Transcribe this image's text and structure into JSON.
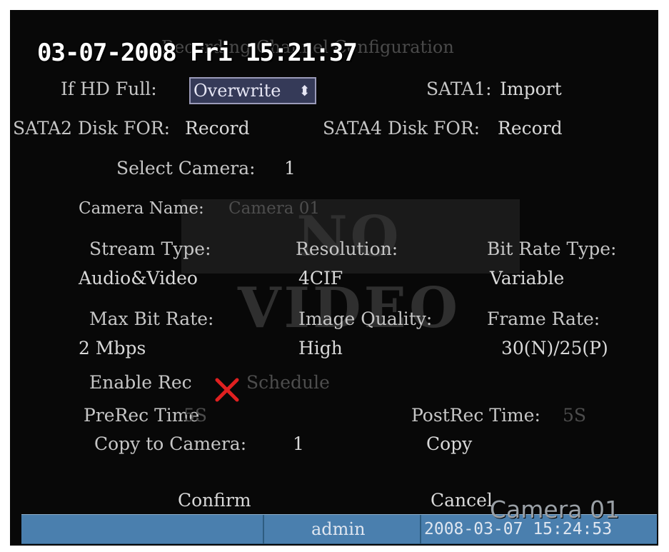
{
  "osd": {
    "datetime": "03-07-2008 Fri 15:21:37",
    "camera_label": "Camera 01",
    "no_video": "NO VIDEO"
  },
  "dialog": {
    "title": "Recording Channel Configuration",
    "hd_full_label": "If HD Full:",
    "hd_full_value": "Overwrite",
    "hd_full_arrows": "⬍",
    "sata1_label": "SATA1:",
    "sata1_value": "Import",
    "sata2_label": "SATA2 Disk FOR:",
    "sata2_value": "Record",
    "sata4_label": "SATA4 Disk FOR:",
    "sata4_value": "Record",
    "select_camera_label": "Select Camera:",
    "select_camera_value": "1",
    "camera_name_label": "Camera Name:",
    "camera_name_value": "Camera 01",
    "stream_type_label": "Stream Type:",
    "stream_type_value": "Audio&Video",
    "resolution_label": "Resolution:",
    "resolution_value": "4CIF",
    "bit_rate_type_label": "Bit Rate Type:",
    "bit_rate_type_value": "Variable",
    "max_bit_rate_label": "Max Bit Rate:",
    "max_bit_rate_value": "2 Mbps",
    "image_quality_label": "Image Quality:",
    "image_quality_value": "High",
    "frame_rate_label": "Frame Rate:",
    "frame_rate_value": "30(N)/25(P)",
    "enable_rec_label": "Enable Rec",
    "enable_rec_checked": false,
    "schedule_label": "Schedule",
    "prerec_label": "PreRec Time",
    "prerec_value": "5S",
    "postrec_label": "PostRec Time:",
    "postrec_value": "5S",
    "copy_to_camera_label": "Copy to Camera:",
    "copy_to_camera_value": "1",
    "copy_button": "Copy",
    "confirm_button": "Confirm",
    "cancel_button": "Cancel"
  },
  "status_bar": {
    "user": "admin",
    "datetime": "2008-03-07 15:24:53"
  },
  "colors": {
    "background": "#080808",
    "selected_field": "#353a58",
    "status_bar": "#4a7fae",
    "x_icon": "#e02020"
  }
}
